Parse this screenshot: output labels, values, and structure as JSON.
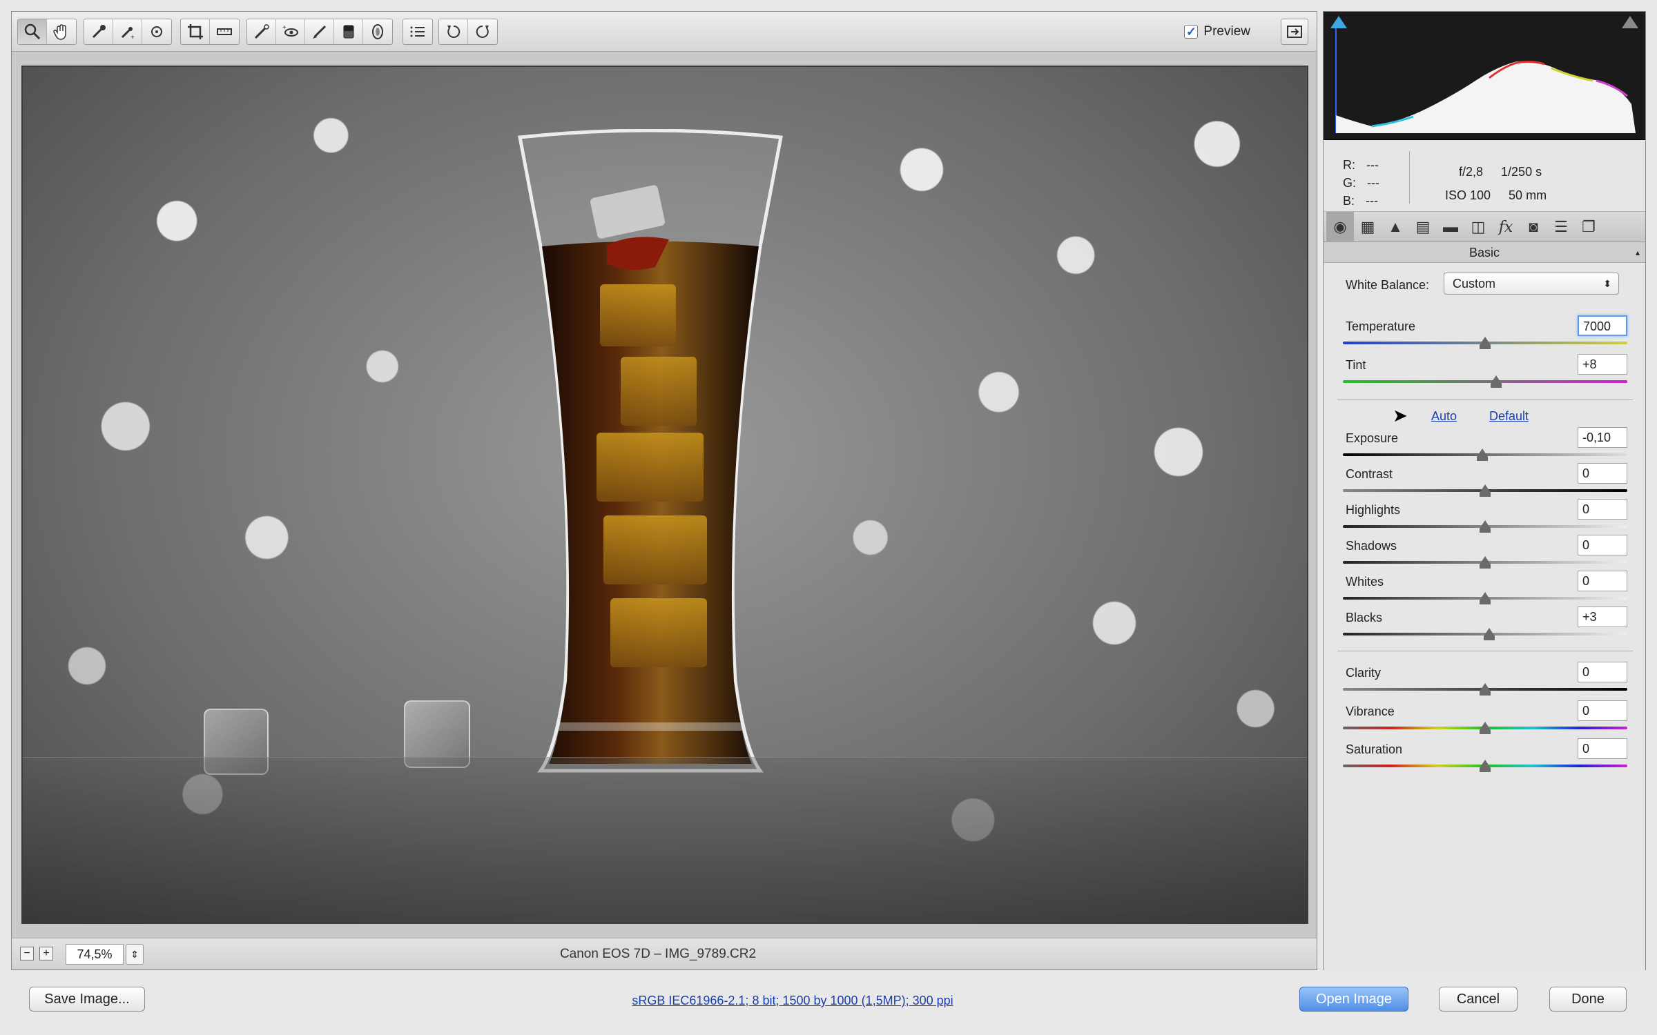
{
  "toolbar": {
    "tool_groups": [
      [
        "zoom-tool",
        "hand-tool"
      ],
      [
        "white-balance-tool",
        "color-sampler-tool",
        "target-adjustment-tool"
      ],
      [
        "crop-tool",
        "straighten-tool"
      ],
      [
        "spot-removal-tool",
        "red-eye-removal-tool",
        "adjustment-brush-tool",
        "graduated-filter-tool",
        "radial-filter-tool"
      ],
      [
        "preferences-tool"
      ],
      [
        "rotate-left-tool",
        "rotate-right-tool"
      ]
    ],
    "preview_label": "Preview",
    "preview_checked": true
  },
  "statusbar": {
    "zoom_value": "74,5%",
    "file_info": "Canon EOS 7D  –  IMG_9789.CR2"
  },
  "readout": {
    "r_label": "R:",
    "r_value": "---",
    "g_label": "G:",
    "g_value": "---",
    "b_label": "B:",
    "b_value": "---",
    "aperture": "f/2,8",
    "shutter": "1/250 s",
    "iso": "ISO 100",
    "focal_length": "50 mm"
  },
  "panel_tabs": [
    "basic-icon",
    "tone-curve-icon",
    "detail-icon",
    "hsl-icon",
    "split-toning-icon",
    "lens-corrections-icon",
    "effects-icon",
    "camera-calibration-icon",
    "presets-icon",
    "snapshots-icon"
  ],
  "section_title": "Basic",
  "white_balance": {
    "label": "White Balance:",
    "value": "Custom"
  },
  "sliders": {
    "temperature": {
      "label": "Temperature",
      "value": "7000",
      "level": 0.5
    },
    "tint": {
      "label": "Tint",
      "value": "+8",
      "level": 0.54
    },
    "exposure": {
      "label": "Exposure",
      "value": "-0,10",
      "level": 0.49
    },
    "contrast": {
      "label": "Contrast",
      "value": "0",
      "level": 0.5
    },
    "highlights": {
      "label": "Highlights",
      "value": "0",
      "level": 0.5
    },
    "shadows": {
      "label": "Shadows",
      "value": "0",
      "level": 0.5
    },
    "whites": {
      "label": "Whites",
      "value": "0",
      "level": 0.5
    },
    "blacks": {
      "label": "Blacks",
      "value": "+3",
      "level": 0.515
    },
    "clarity": {
      "label": "Clarity",
      "value": "0",
      "level": 0.5
    },
    "vibrance": {
      "label": "Vibrance",
      "value": "0",
      "level": 0.5
    },
    "saturation": {
      "label": "Saturation",
      "value": "0",
      "level": 0.5
    }
  },
  "links": {
    "auto": "Auto",
    "default": "Default"
  },
  "buttons": {
    "save_image": "Save Image...",
    "open_image": "Open Image",
    "cancel": "Cancel",
    "done": "Done"
  },
  "workflow_options": "sRGB IEC61966-2.1; 8 bit; 1500 by 1000 (1,5MP); 300 ppi",
  "colors": {
    "accent": "#4f8fe6",
    "link": "#1a3fa8",
    "shadow_clip": "#3fa8e0"
  }
}
